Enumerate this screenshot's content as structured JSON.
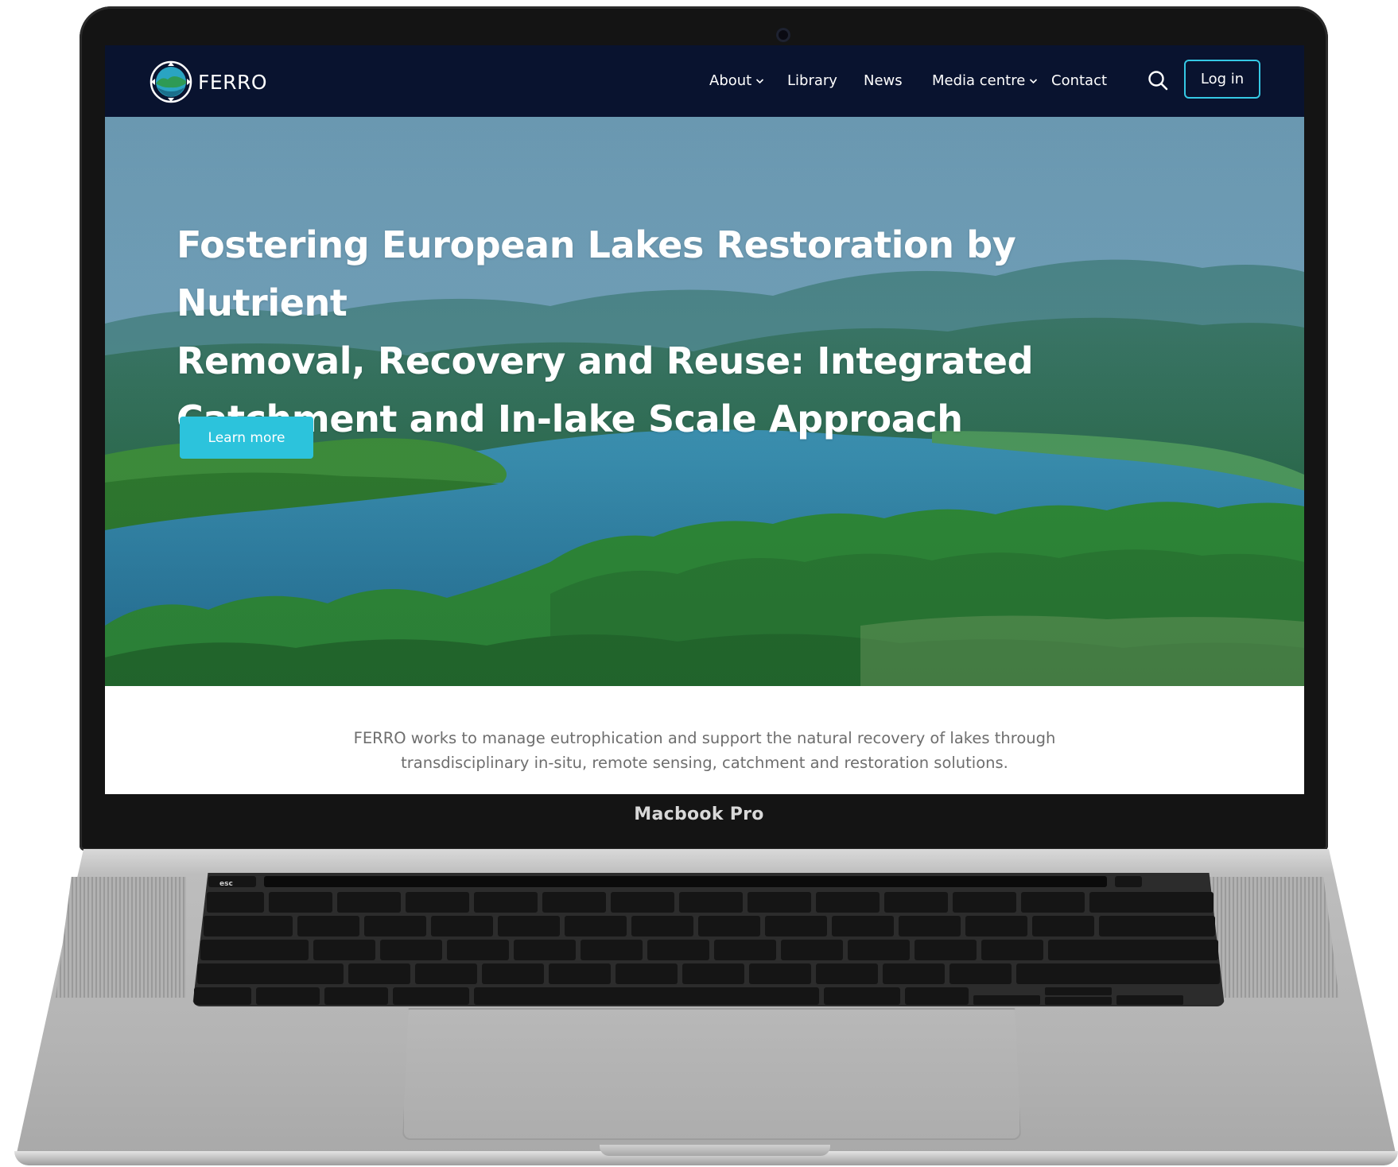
{
  "site": {
    "logo_text": "FERRO",
    "nav": [
      {
        "label": "About",
        "has_dropdown": true
      },
      {
        "label": "Library",
        "has_dropdown": false
      },
      {
        "label": "News",
        "has_dropdown": false
      },
      {
        "label": "Media centre",
        "has_dropdown": true
      },
      {
        "label": "Contact",
        "has_dropdown": false
      }
    ],
    "search_icon": "search-icon",
    "login_label": "Log in"
  },
  "hero": {
    "title_lines": [
      "Fostering European Lakes Restoration by Nutrient",
      "Removal, Recovery and Reuse: Integrated",
      "Catchment and In-lake Scale Approach"
    ],
    "cta_label": "Learn more"
  },
  "intro": {
    "lines": [
      "FERRO works to manage eutrophication and support the natural recovery of lakes through",
      "transdisciplinary in-situ, remote sensing, catchment and restoration solutions."
    ]
  },
  "device": {
    "label": "Macbook Pro"
  },
  "colors": {
    "navbar": "#09132f",
    "accent": "#2cc3dc",
    "login_border": "#35c8e4",
    "intro_text": "#6e6e6e"
  }
}
